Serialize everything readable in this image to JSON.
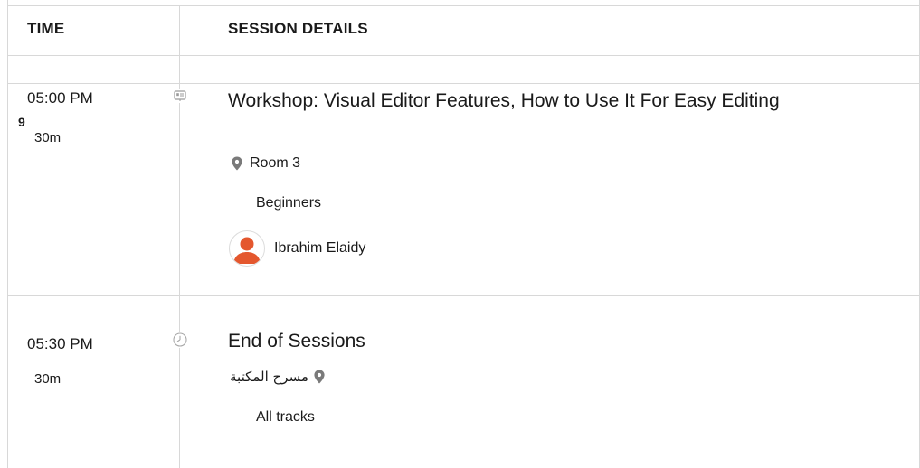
{
  "header": {
    "time_label": "TIME",
    "details_label": "SESSION DETAILS"
  },
  "sessions": [
    {
      "time": "05:00 PM",
      "badge": "9",
      "duration": "30m",
      "title": "Workshop: Visual Editor Features, How to Use It For Easy Editing",
      "location": "Room 3",
      "location_icon": "map-pin-icon",
      "track": "Beginners",
      "timeline_icon": "presentation-icon",
      "speaker": {
        "name": "Ibrahim Elaidy",
        "avatar_icon": "user-avatar-icon"
      }
    },
    {
      "time": "05:30 PM",
      "duration": "30m",
      "title": "End of Sessions",
      "location": "مسرح المكتبة",
      "location_icon": "map-pin-icon",
      "track": "All tracks",
      "timeline_icon": "clock-icon"
    }
  ],
  "colors": {
    "border": "#d8d8d8",
    "text": "#1a1a1a",
    "avatar_accent": "#e4572e",
    "icon_gray": "#7a7a7a"
  }
}
